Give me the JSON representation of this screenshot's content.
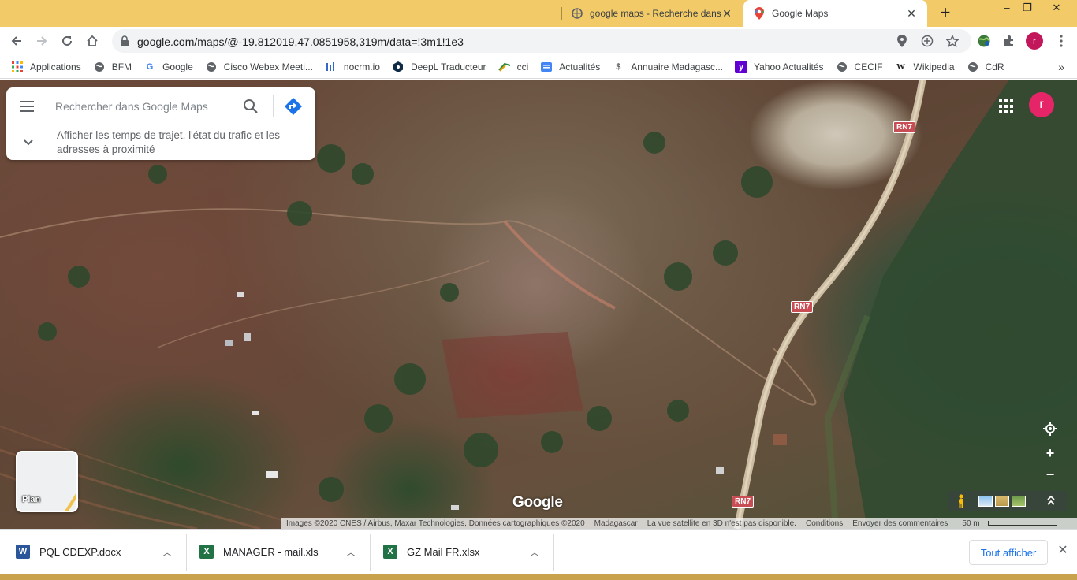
{
  "browser": {
    "tabs": [
      {
        "title": "google maps - Recherche dans Google",
        "icon": "google-search-favicon",
        "active": false
      },
      {
        "title": "Google Maps",
        "icon": "google-maps-favicon",
        "active": true
      }
    ],
    "new_tab_label": "+",
    "window_controls": {
      "minimize": "–",
      "restore": "❐",
      "close": "✕"
    },
    "url": "google.com/maps/@-19.812019,47.0851958,319m/data=!3m1!1e3",
    "profile_initial": "r",
    "bookmarks": [
      {
        "label": "Applications",
        "icon": "apps-grid-icon"
      },
      {
        "label": "BFM",
        "icon": "globe-icon"
      },
      {
        "label": "Google",
        "icon": "google-icon"
      },
      {
        "label": "Cisco Webex Meeti...",
        "icon": "globe-icon"
      },
      {
        "label": "nocrm.io",
        "icon": "nocrm-icon"
      },
      {
        "label": "DeepL Traducteur",
        "icon": "deepl-icon"
      },
      {
        "label": "cci",
        "icon": "cci-icon"
      },
      {
        "label": "Actualités",
        "icon": "news-icon"
      },
      {
        "label": "Annuaire Madagasc...",
        "icon": "annuaire-icon"
      },
      {
        "label": "Yahoo Actualités",
        "icon": "yahoo-icon"
      },
      {
        "label": "CECIF",
        "icon": "globe-icon"
      },
      {
        "label": "Wikipedia",
        "icon": "wikipedia-icon"
      },
      {
        "label": "CdR",
        "icon": "globe-icon"
      }
    ],
    "bookmarks_overflow": "»"
  },
  "maps": {
    "search_placeholder": "Rechercher dans Google Maps",
    "hint_text": "Afficher les temps de trajet, l'état du trafic et les adresses à proximité",
    "account_initial": "r",
    "road_labels": [
      "RN7",
      "RN7",
      "RN7"
    ],
    "layer_switch_label": "Plan",
    "logo_text": "Google",
    "attribution": {
      "imagery": "Images ©2020 CNES / Airbus, Maxar Technologies, Données cartographiques ©2020",
      "region": "Madagascar",
      "notice": "La vue satellite en 3D n'est pas disponible.",
      "terms": "Conditions",
      "feedback": "Envoyer des commentaires",
      "scale": "50 m"
    }
  },
  "downloads": {
    "items": [
      {
        "name": "PQL CDEXP.docx",
        "icon": "word-file-icon"
      },
      {
        "name": "MANAGER - mail.xls",
        "icon": "excel-file-icon"
      },
      {
        "name": "GZ Mail FR.xlsx",
        "icon": "excel-file-icon"
      }
    ],
    "show_all_label": "Tout afficher",
    "close_label": "✕"
  },
  "colors": {
    "tabstrip": "#f2ca68",
    "maps_blue": "#1a73e8",
    "road_label": "#c94d54",
    "avatar": "#e52567"
  }
}
